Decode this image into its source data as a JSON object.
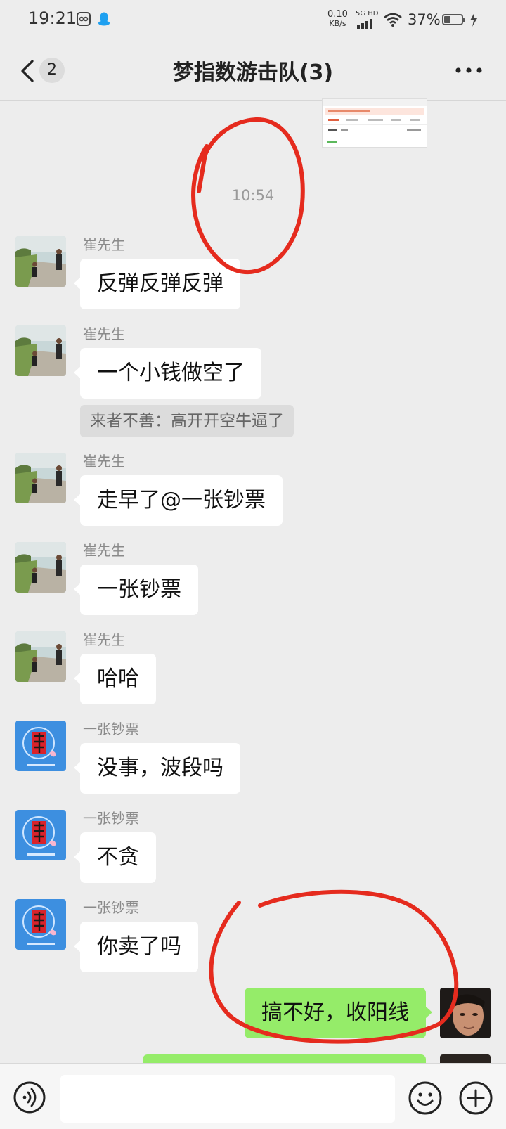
{
  "status_bar": {
    "time": "19:21",
    "net_speed": "0.10",
    "net_unit": "KB/s",
    "signal_label": "5G HD",
    "battery": "37%",
    "battery_level": 0.37
  },
  "header": {
    "back_badge": "2",
    "title": "梦指数游击队(3)"
  },
  "chat": {
    "timestamp": "10:54",
    "messages": [
      {
        "sender": "崔先生",
        "text": "反弹反弹反弹"
      },
      {
        "sender": "崔先生",
        "text": "一个小钱做空了",
        "quote": "来者不善：高开开空牛逼了"
      },
      {
        "sender": "崔先生",
        "text": "走早了@一张钞票"
      },
      {
        "sender": "崔先生",
        "text": "一张钞票"
      },
      {
        "sender": "崔先生",
        "text": "哈哈"
      },
      {
        "sender": "一张钞票",
        "text": "没事，波段吗"
      },
      {
        "sender": "一张钞票",
        "text": "不贪"
      },
      {
        "sender": "一张钞票",
        "text": "你卖了吗"
      }
    ],
    "my_messages": [
      {
        "text": "搞不好，收阳线"
      }
    ]
  },
  "colors": {
    "background": "#ededed",
    "bubble_in": "#ffffff",
    "bubble_out": "#95ec69",
    "annotation": "#e52b1e"
  },
  "icons": {
    "back": "chevron-left-icon",
    "more": "more-dots-icon",
    "voice": "voice-icon",
    "emoji": "emoji-icon",
    "plus": "plus-icon"
  }
}
